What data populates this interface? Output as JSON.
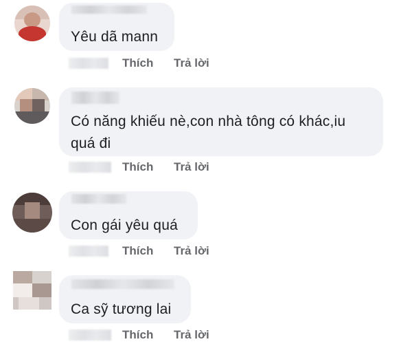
{
  "comments": [
    {
      "text": "Yêu dã mann",
      "like_label": "Thích",
      "reply_label": "Trả lời"
    },
    {
      "text": "Có năng khiếu nè,con nhà tông có khác,iu quá đi",
      "like_label": "Thích",
      "reply_label": "Trả lời"
    },
    {
      "text": "Con gái yêu quá",
      "like_label": "Thích",
      "reply_label": "Trả lời"
    },
    {
      "text": "Ca sỹ tương lai",
      "like_label": "Thích",
      "reply_label": "Trả lời"
    }
  ],
  "colors": {
    "bubble_background": "#f0f2f5",
    "comment_text": "#1c1e21",
    "action_text": "#65676b"
  }
}
